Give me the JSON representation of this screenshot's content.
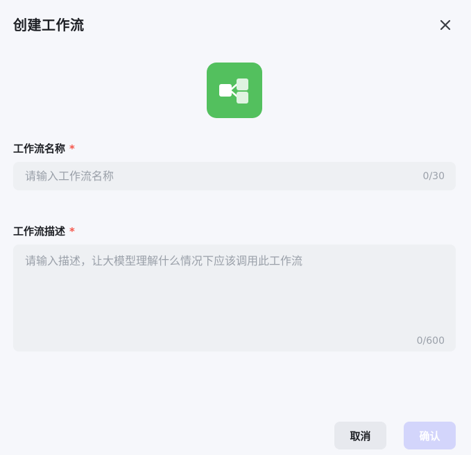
{
  "dialog": {
    "title": "创建工作流",
    "icon": "workflow-icon",
    "accent_color": "#53c05e"
  },
  "form": {
    "name": {
      "label": "工作流名称",
      "required_mark": "*",
      "placeholder": "请输入工作流名称",
      "value": "",
      "counter": "0/30"
    },
    "description": {
      "label": "工作流描述",
      "required_mark": "*",
      "placeholder": "请输入描述，让大模型理解什么情况下应该调用此工作流",
      "value": "",
      "counter": "0/600"
    }
  },
  "actions": {
    "cancel_label": "取消",
    "confirm_label": "确认",
    "confirm_color": "#d3d5fb"
  }
}
